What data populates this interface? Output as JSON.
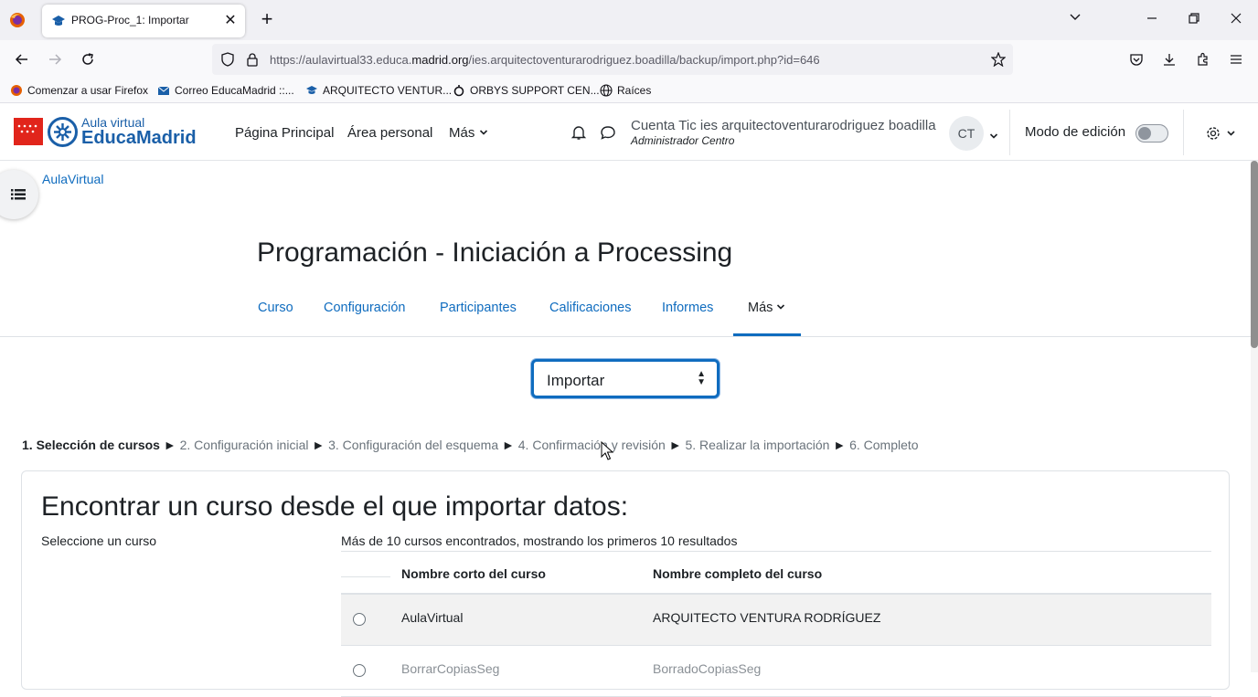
{
  "browser": {
    "tab_title": "PROG-Proc_1: Importar",
    "url_prefix": "https://aulavirtual33.educa.",
    "url_domain": "madrid.org",
    "url_path": "/ies.arquitectoventurarodriguez.boadilla/backup/import.php?id=646",
    "bookmarks": [
      {
        "label": "Comenzar a usar Firefox"
      },
      {
        "label": "Correo EducaMadrid ::..."
      },
      {
        "label": "ARQUITECTO VENTUR..."
      },
      {
        "label": "ORBYS SUPPORT CEN..."
      },
      {
        "label": "Raíces"
      }
    ]
  },
  "header": {
    "logo_small": "Aula virtual",
    "logo_big": "EducaMadrid",
    "nav": [
      "Página Principal",
      "Área personal",
      "Más"
    ],
    "user_name": "Cuenta Tic ies arquitectoventurarodriguez boadilla",
    "user_role": "Administrador Centro",
    "avatar_initials": "CT",
    "edit_mode_label": "Modo de edición",
    "edit_mode_on": false
  },
  "breadcrumb": "AulaVirtual",
  "course": {
    "title": "Programación - Iniciación a Processing",
    "tabs": [
      "Curso",
      "Configuración",
      "Participantes",
      "Calificaciones",
      "Informes",
      "Más"
    ],
    "active_tab": "Más"
  },
  "action_select": {
    "value": "Importar"
  },
  "steps": {
    "current": "1. Selección de cursos",
    "others": [
      "2. Configuración inicial",
      "3. Configuración del esquema",
      "4. Confirmación y revisión",
      "5. Realizar la importación",
      "6. Completo"
    ],
    "separator": "►"
  },
  "import": {
    "title": "Encontrar un curso desde el que importar datos:",
    "select_label": "Seleccione un curso",
    "found_text": "Más de 10 cursos encontrados, mostrando los primeros 10 resultados",
    "columns": [
      "Nombre corto del curso",
      "Nombre completo del curso"
    ],
    "rows": [
      {
        "short": "AulaVirtual",
        "full": "ARQUITECTO VENTURA RODRÍGUEZ"
      },
      {
        "short": "BorrarCopiasSeg",
        "full": "BorradoCopiasSeg"
      }
    ]
  }
}
